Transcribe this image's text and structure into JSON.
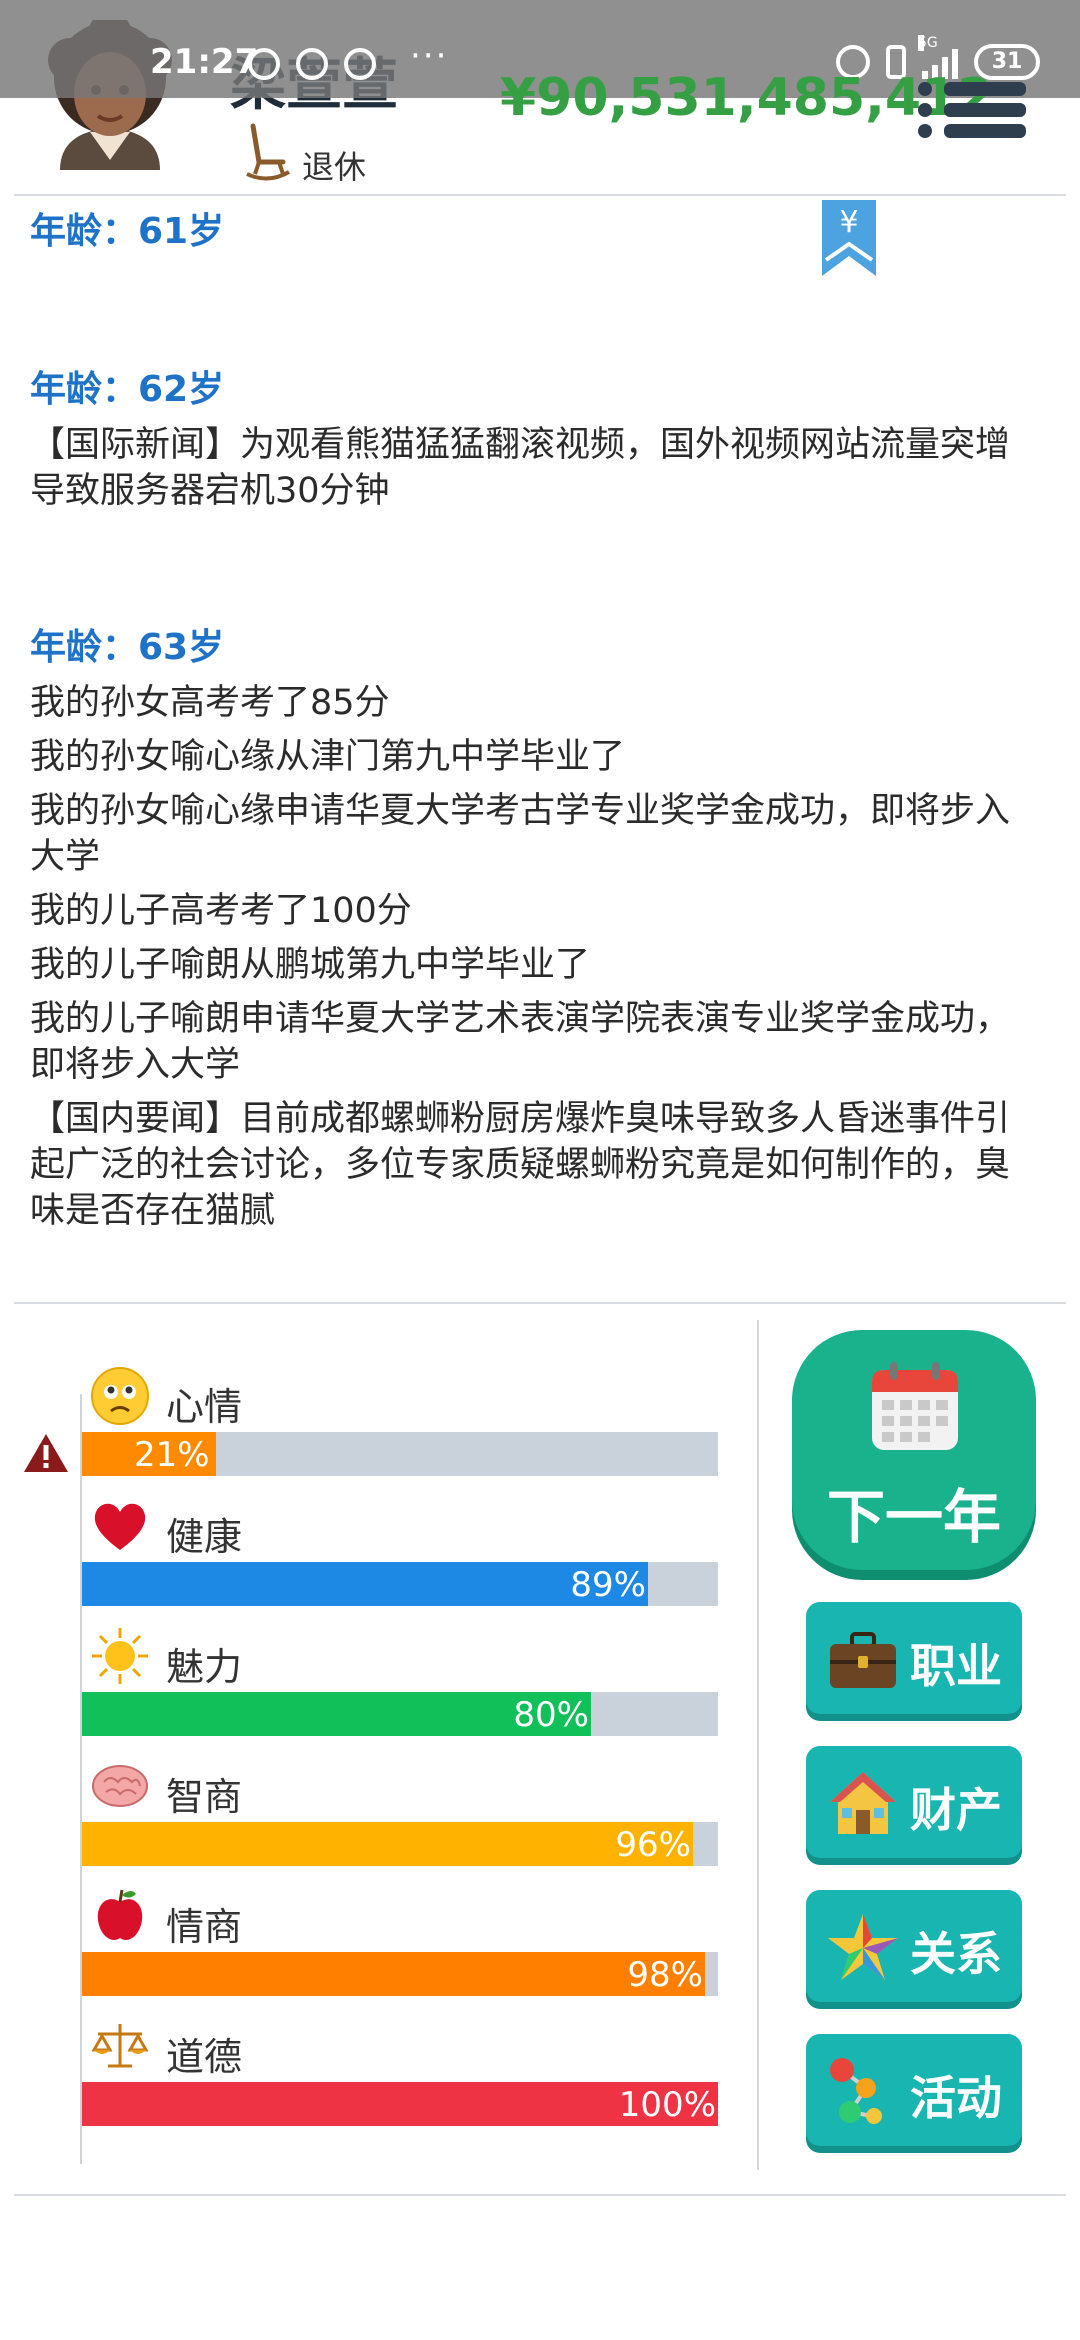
{
  "status_bar": {
    "time": "21:27",
    "dots": "···",
    "network": "5G",
    "battery": "31"
  },
  "header": {
    "name": "梁萱萱",
    "status_label": "退休",
    "money": "¥90,531,485,412"
  },
  "log": {
    "bookmark_symbol": "¥",
    "sections": [
      {
        "age": "年龄：61岁",
        "entries": []
      },
      {
        "age": "年龄：62岁",
        "entries": [
          "【国际新闻】为观看熊猫猛猛翻滚视频，国外视频网站流量突增导致服务器宕机30分钟"
        ]
      },
      {
        "age": "年龄：63岁",
        "entries": [
          "我的孙女高考考了85分",
          "我的孙女喻心缘从津门第九中学毕业了",
          "我的孙女喻心缘申请华夏大学考古学专业奖学金成功，即将步入大学",
          "我的儿子高考考了100分",
          "我的儿子喻朗从鹏城第九中学毕业了",
          "我的儿子喻朗申请华夏大学艺术表演学院表演专业奖学金成功，即将步入大学",
          "【国内要闻】目前成都螺蛳粉厨房爆炸臭味导致多人昏迷事件引起广泛的社会讨论，多位专家质疑螺蛳粉究竟是如何制作的，臭味是否存在猫腻"
        ]
      }
    ]
  },
  "stats": [
    {
      "label": "心情",
      "value": 21,
      "pct": "21%",
      "color": "#ff8a00",
      "icon": "sad-face-icon"
    },
    {
      "label": "健康",
      "value": 89,
      "pct": "89%",
      "color": "#1e88e5",
      "icon": "heart-icon"
    },
    {
      "label": "魅力",
      "value": 80,
      "pct": "80%",
      "color": "#12c05a",
      "icon": "sun-icon"
    },
    {
      "label": "智商",
      "value": 96,
      "pct": "96%",
      "color": "#ffb300",
      "icon": "brain-icon"
    },
    {
      "label": "情商",
      "value": 98,
      "pct": "98%",
      "color": "#ff8000",
      "icon": "apple-icon"
    },
    {
      "label": "道德",
      "value": 100,
      "pct": "100%",
      "color": "#ee3344",
      "icon": "scale-icon"
    }
  ],
  "buttons": {
    "next_year": "下一年",
    "career": "职业",
    "property": "财产",
    "relations": "关系",
    "activities": "活动"
  }
}
